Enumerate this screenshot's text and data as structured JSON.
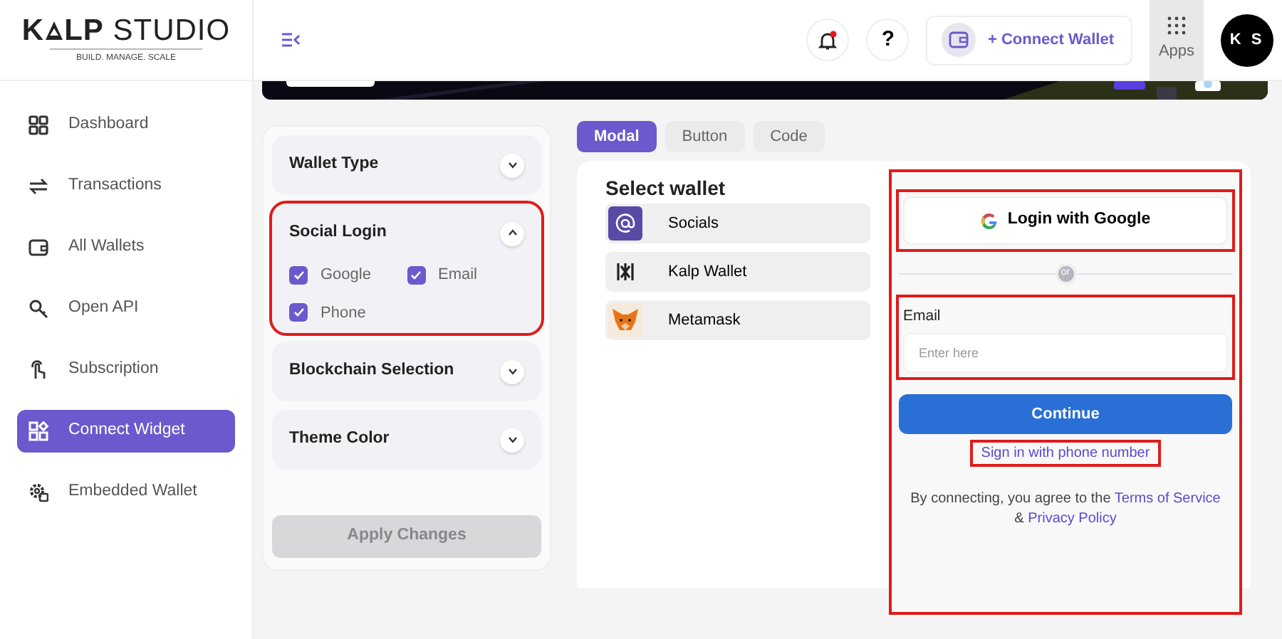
{
  "brand": {
    "initial": "K",
    "rest": "**LP** STUDIO",
    "tagline": "BUILD. MANAGE. SCALE"
  },
  "sidebar": {
    "items": [
      {
        "label": "Dashboard",
        "selected": false
      },
      {
        "label": "Transactions",
        "selected": false
      },
      {
        "label": "All Wallets",
        "selected": false
      },
      {
        "label": "Open API",
        "selected": false
      },
      {
        "label": "Subscription",
        "selected": false
      },
      {
        "label": "Connect Widget",
        "selected": true
      },
      {
        "label": "Embedded Wallet",
        "selected": false
      }
    ]
  },
  "header": {
    "help": "?",
    "connect_wallet": "+ Connect Wallet",
    "apps": "Apps",
    "avatar": "K S",
    "has_notification": true
  },
  "settings": {
    "sections": [
      {
        "title": "Wallet Type",
        "expanded": false,
        "highlighted": false
      },
      {
        "title": "Social Login",
        "expanded": true,
        "highlighted": true,
        "options": [
          {
            "label": "Google",
            "checked": true
          },
          {
            "label": "Email",
            "checked": true
          },
          {
            "label": "Phone",
            "checked": true
          }
        ]
      },
      {
        "title": "Blockchain Selection",
        "expanded": false,
        "highlighted": false
      },
      {
        "title": "Theme Color",
        "expanded": false,
        "highlighted": false
      }
    ],
    "apply_button": {
      "label": "Apply Changes",
      "disabled": true
    }
  },
  "tabs": [
    {
      "label": "Modal",
      "selected": true
    },
    {
      "label": "Button",
      "selected": false
    },
    {
      "label": "Code",
      "selected": false
    }
  ],
  "preview": {
    "title": "Select wallet",
    "wallets": [
      {
        "label": "Socials",
        "kind": "socials"
      },
      {
        "label": "Kalp Wallet",
        "kind": "kalp"
      },
      {
        "label": "Metamask",
        "kind": "metamask"
      }
    ],
    "login": {
      "highlighted": true,
      "google": {
        "label": "Login with Google",
        "highlighted": true
      },
      "divider": "or",
      "email": {
        "label": "Email",
        "placeholder": "Enter here",
        "highlighted": true
      },
      "continue": "Continue",
      "phone_link": {
        "label": "Sign in with phone number",
        "highlighted": true
      },
      "terms_prefix": "By connecting, you agree to the",
      "terms_link": "Terms of Service",
      "amp": "&",
      "privacy_link": "Privacy Policy"
    }
  }
}
